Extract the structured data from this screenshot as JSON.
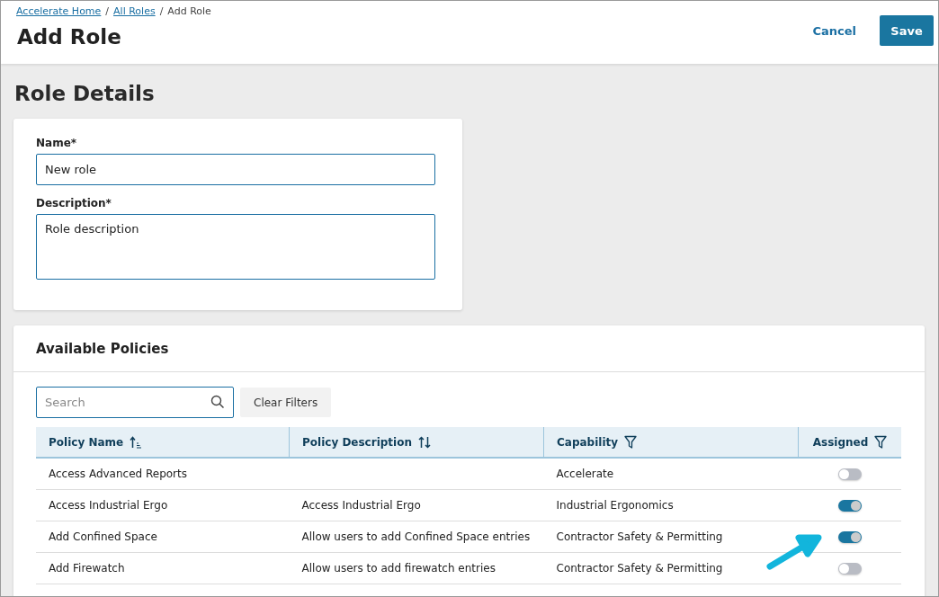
{
  "breadcrumbs": [
    {
      "label": "Accelerate Home",
      "kind": "link"
    },
    {
      "label": "/",
      "kind": "separator"
    },
    {
      "label": "All Roles",
      "kind": "link"
    },
    {
      "label": "/",
      "kind": "separator"
    },
    {
      "label": "Add Role",
      "kind": "current"
    }
  ],
  "page_title": "Add Role",
  "actions": [
    {
      "label": "Cancel",
      "kind": "secondary"
    },
    {
      "label": "Save",
      "kind": "primary"
    }
  ],
  "section_title": "Role Details",
  "fields": [
    {
      "label": "Name*",
      "kind": "input",
      "value": "New role"
    },
    {
      "label": "Description*",
      "kind": "textarea",
      "value": "Role description"
    }
  ],
  "policies": {
    "title": "Available Policies",
    "search": {
      "placeholder": "Search"
    },
    "clear_button": "Clear Filters",
    "columns": [
      {
        "label": "Policy Name",
        "kind": "sort_asc"
      },
      {
        "label": "Policy Description",
        "kind": "sort"
      },
      {
        "label": "Capability",
        "kind": "filter"
      },
      {
        "label": "Assigned",
        "kind": "filter"
      }
    ],
    "rows": [
      {
        "name": "Access Advanced Reports",
        "capability": "Accelerate",
        "assigned": false
      },
      {
        "name": "Access Industrial Ergo",
        "description": "Access Industrial Ergo",
        "capability": "Industrial Ergonomics",
        "assigned": true
      },
      {
        "name": "Add Confined Space",
        "description": "Allow users to add Confined Space entries",
        "capability": "Contractor Safety & Permitting",
        "assigned": true
      },
      {
        "name": "Add Firewatch",
        "description": "Allow users to add firewatch entries",
        "capability": "Contractor Safety & Permitting",
        "assigned": false
      }
    ]
  }
}
